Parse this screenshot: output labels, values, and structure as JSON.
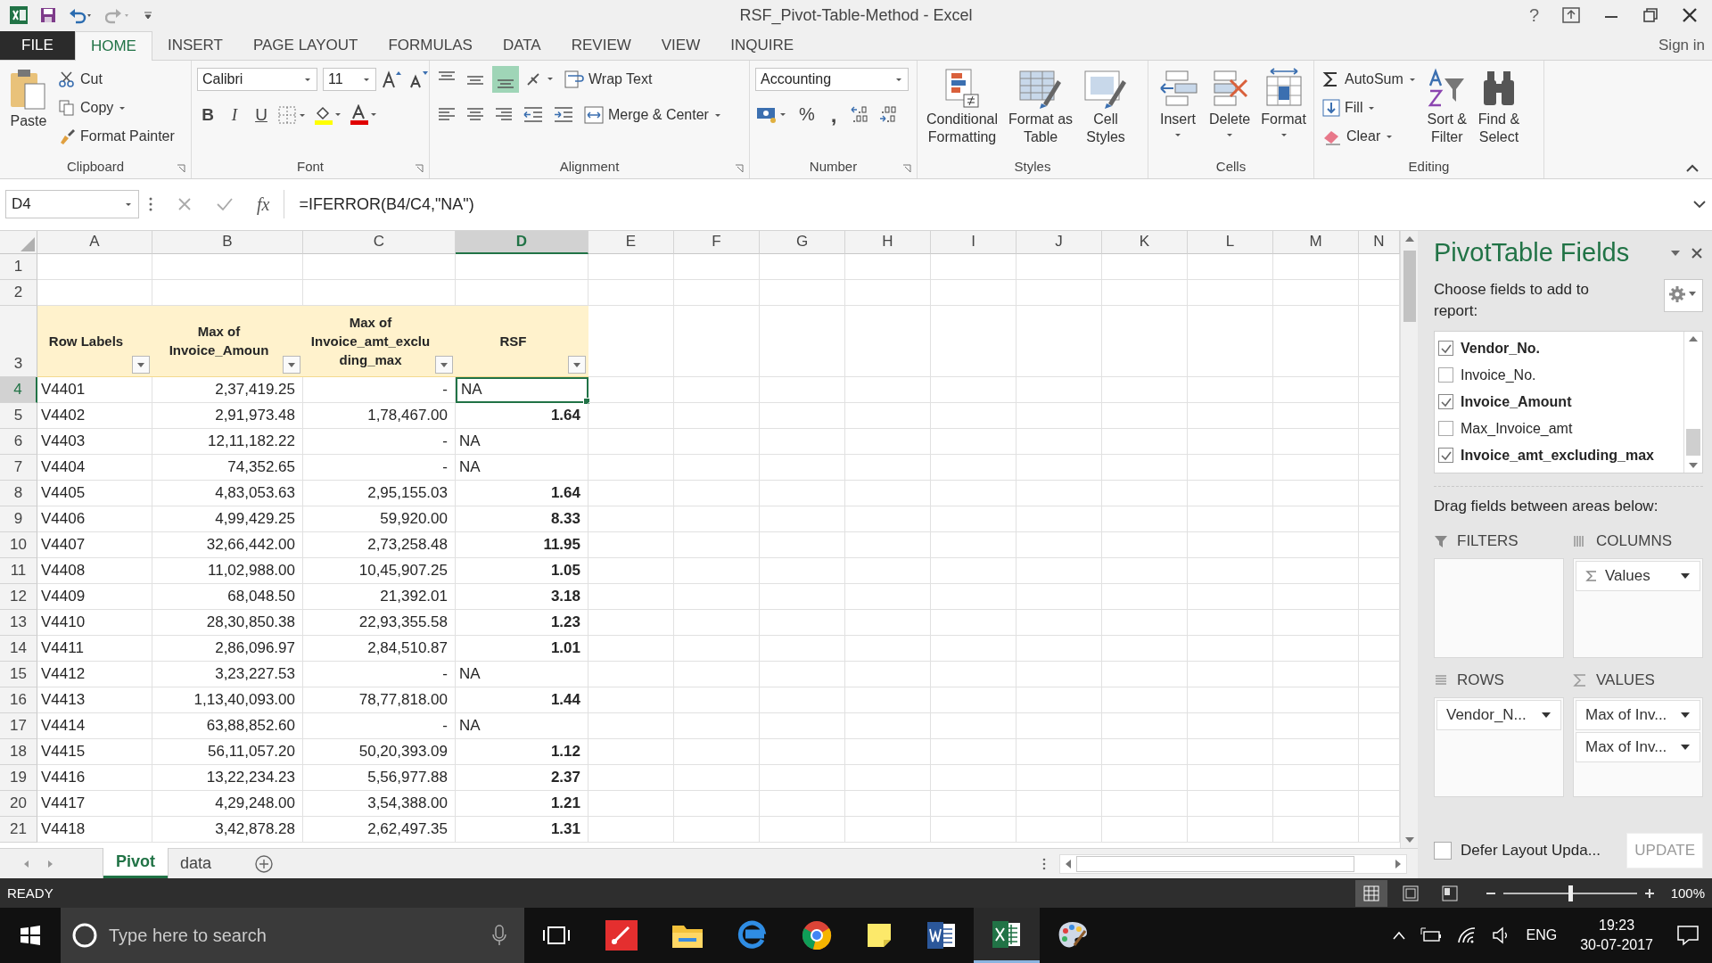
{
  "window": {
    "title": "RSF_Pivot-Table-Method - Excel",
    "help": "?",
    "sign_in": "Sign in"
  },
  "ribbon_tabs": [
    {
      "label": "FILE",
      "kind": "file",
      "selected": false
    },
    {
      "label": "HOME",
      "kind": "tab",
      "selected": true
    },
    {
      "label": "INSERT",
      "kind": "tab",
      "selected": false
    },
    {
      "label": "PAGE LAYOUT",
      "kind": "tab",
      "selected": false
    },
    {
      "label": "FORMULAS",
      "kind": "tab",
      "selected": false
    },
    {
      "label": "DATA",
      "kind": "tab",
      "selected": false
    },
    {
      "label": "REVIEW",
      "kind": "tab",
      "selected": false
    },
    {
      "label": "VIEW",
      "kind": "tab",
      "selected": false
    },
    {
      "label": "INQUIRE",
      "kind": "tab",
      "selected": false
    }
  ],
  "ribbon": {
    "clipboard": {
      "label": "Clipboard",
      "paste": "Paste",
      "cut": "Cut",
      "copy": "Copy",
      "format_painter": "Format Painter"
    },
    "font": {
      "label": "Font",
      "name": "Calibri",
      "size": "11",
      "bold": "B",
      "italic": "I",
      "underline": "U"
    },
    "alignment": {
      "label": "Alignment",
      "wrap_text": "Wrap Text",
      "merge_center": "Merge & Center"
    },
    "number": {
      "label": "Number",
      "format": "Accounting",
      "percent": "%",
      "comma": ","
    },
    "styles": {
      "label": "Styles",
      "buttons": [
        "Conditional\nFormatting",
        "Format as\nTable",
        "Cell\nStyles"
      ]
    },
    "cells": {
      "label": "Cells",
      "buttons": [
        "Insert",
        "Delete",
        "Format"
      ]
    },
    "editing": {
      "label": "Editing",
      "autosum": "AutoSum",
      "fill": "Fill",
      "clear": "Clear",
      "sort_filter": "Sort &\nFilter",
      "find_select": "Find &\nSelect"
    }
  },
  "formula_bar": {
    "name_box": "D4",
    "fx": "fx",
    "formula": "=IFERROR(B4/C4,\"NA\")"
  },
  "sheet": {
    "columns": [
      {
        "label": "A",
        "selected": false
      },
      {
        "label": "B",
        "selected": false
      },
      {
        "label": "C",
        "selected": false
      },
      {
        "label": "D",
        "selected": true
      },
      {
        "label": "E",
        "selected": false
      },
      {
        "label": "F",
        "selected": false
      },
      {
        "label": "G",
        "selected": false
      },
      {
        "label": "H",
        "selected": false
      },
      {
        "label": "I",
        "selected": false
      },
      {
        "label": "J",
        "selected": false
      },
      {
        "label": "K",
        "selected": false
      },
      {
        "label": "L",
        "selected": false
      },
      {
        "label": "M",
        "selected": false
      },
      {
        "label": "N",
        "selected": false
      }
    ],
    "empty_rows": [
      {
        "number": "1"
      },
      {
        "number": "2"
      }
    ],
    "header_row": {
      "number": "3",
      "cells": [
        "Row Labels",
        "Max of Invoice_Amoun",
        "Max of Invoice_amt_exclu ding_max",
        "RSF"
      ]
    },
    "rows": [
      {
        "number": "4",
        "selected": true,
        "kind": "na",
        "label": "V4401",
        "amount": "2,37,419.25",
        "excluding": "-",
        "rsf": "NA"
      },
      {
        "number": "5",
        "selected": false,
        "kind": "value",
        "label": "V4402",
        "amount": "2,91,973.48",
        "excluding": "1,78,467.00",
        "rsf": "1.64"
      },
      {
        "number": "6",
        "selected": false,
        "kind": "na",
        "label": "V4403",
        "amount": "12,11,182.22",
        "excluding": "-",
        "rsf": "NA"
      },
      {
        "number": "7",
        "selected": false,
        "kind": "na",
        "label": "V4404",
        "amount": "74,352.65",
        "excluding": "-",
        "rsf": "NA"
      },
      {
        "number": "8",
        "selected": false,
        "kind": "value",
        "label": "V4405",
        "amount": "4,83,053.63",
        "excluding": "2,95,155.03",
        "rsf": "1.64"
      },
      {
        "number": "9",
        "selected": false,
        "kind": "value",
        "label": "V4406",
        "amount": "4,99,429.25",
        "excluding": "59,920.00",
        "rsf": "8.33"
      },
      {
        "number": "10",
        "selected": false,
        "kind": "value",
        "label": "V4407",
        "amount": "32,66,442.00",
        "excluding": "2,73,258.48",
        "rsf": "11.95"
      },
      {
        "number": "11",
        "selected": false,
        "kind": "value",
        "label": "V4408",
        "amount": "11,02,988.00",
        "excluding": "10,45,907.25",
        "rsf": "1.05"
      },
      {
        "number": "12",
        "selected": false,
        "kind": "value",
        "label": "V4409",
        "amount": "68,048.50",
        "excluding": "21,392.01",
        "rsf": "3.18"
      },
      {
        "number": "13",
        "selected": false,
        "kind": "value",
        "label": "V4410",
        "amount": "28,30,850.38",
        "excluding": "22,93,355.58",
        "rsf": "1.23"
      },
      {
        "number": "14",
        "selected": false,
        "kind": "value",
        "label": "V4411",
        "amount": "2,86,096.97",
        "excluding": "2,84,510.87",
        "rsf": "1.01"
      },
      {
        "number": "15",
        "selected": false,
        "kind": "na",
        "label": "V4412",
        "amount": "3,23,227.53",
        "excluding": "-",
        "rsf": "NA"
      },
      {
        "number": "16",
        "selected": false,
        "kind": "value",
        "label": "V4413",
        "amount": "1,13,40,093.00",
        "excluding": "78,77,818.00",
        "rsf": "1.44"
      },
      {
        "number": "17",
        "selected": false,
        "kind": "na",
        "label": "V4414",
        "amount": "63,88,852.60",
        "excluding": "-",
        "rsf": "NA"
      },
      {
        "number": "18",
        "selected": false,
        "kind": "value",
        "label": "V4415",
        "amount": "56,11,057.20",
        "excluding": "50,20,393.09",
        "rsf": "1.12"
      },
      {
        "number": "19",
        "selected": false,
        "kind": "value",
        "label": "V4416",
        "amount": "13,22,234.23",
        "excluding": "5,56,977.88",
        "rsf": "2.37"
      },
      {
        "number": "20",
        "selected": false,
        "kind": "value",
        "label": "V4417",
        "amount": "4,29,248.00",
        "excluding": "3,54,388.00",
        "rsf": "1.21"
      },
      {
        "number": "21",
        "selected": false,
        "kind": "value",
        "label": "V4418",
        "amount": "3,42,878.28",
        "excluding": "2,62,497.35",
        "rsf": "1.31"
      }
    ]
  },
  "sheet_tabs": [
    {
      "label": "Pivot",
      "selected": true
    },
    {
      "label": "data",
      "selected": false
    }
  ],
  "pivot": {
    "title": "PivotTable Fields",
    "subtitle": "Choose fields to add to report:",
    "fields": [
      {
        "label": "Vendor_No.",
        "checked": true
      },
      {
        "label": "Invoice_No.",
        "checked": false
      },
      {
        "label": "Invoice_Amount",
        "checked": true
      },
      {
        "label": "Max_Invoice_amt",
        "checked": false
      },
      {
        "label": "Invoice_amt_excluding_max",
        "checked": true
      }
    ],
    "drag_hint": "Drag fields between areas below:",
    "filters": {
      "label": "FILTERS"
    },
    "columns": {
      "label": "COLUMNS",
      "items": [
        "Values"
      ]
    },
    "rows": {
      "label": "ROWS",
      "items": [
        "Vendor_N..."
      ]
    },
    "values": {
      "label": "VALUES",
      "items": [
        "Max of Inv...",
        "Max of Inv..."
      ]
    },
    "defer": {
      "label": "Defer Layout Upda...",
      "checked": false
    },
    "update": "UPDATE"
  },
  "status_bar": {
    "mode": "READY",
    "zoom": "100%",
    "zoom_slider": {
      "level": 0.5
    }
  },
  "taskbar": {
    "search_placeholder": "Type here to search",
    "language": "ENG",
    "time": "19:23",
    "date": "30-07-2017"
  }
}
